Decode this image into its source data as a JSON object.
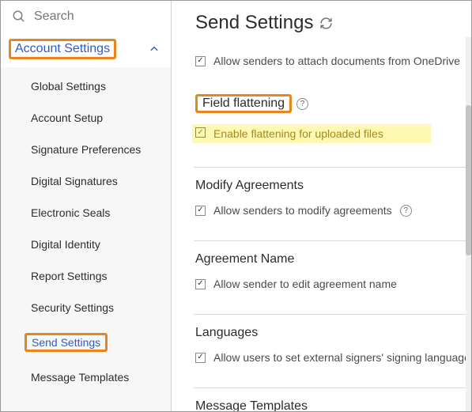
{
  "search": {
    "placeholder": "Search"
  },
  "sidebar": {
    "section_label": "Account Settings",
    "items": [
      {
        "label": "Global Settings"
      },
      {
        "label": "Account Setup"
      },
      {
        "label": "Signature Preferences"
      },
      {
        "label": "Digital Signatures"
      },
      {
        "label": "Electronic Seals"
      },
      {
        "label": "Digital Identity"
      },
      {
        "label": "Report Settings"
      },
      {
        "label": "Security Settings"
      },
      {
        "label": "Send Settings"
      },
      {
        "label": "Message Templates"
      }
    ]
  },
  "page": {
    "title": "Send Settings",
    "onedrive_option": "Allow senders to attach documents from OneDrive",
    "field_flattening": {
      "title": "Field flattening",
      "option": "Enable flattening for uploaded files"
    },
    "modify_agreements": {
      "title": "Modify Agreements",
      "option": "Allow senders to modify agreements"
    },
    "agreement_name": {
      "title": "Agreement Name",
      "option": "Allow sender to edit agreement name"
    },
    "languages": {
      "title": "Languages",
      "option": "Allow users to set external signers' signing language"
    },
    "message_templates": {
      "title": "Message Templates"
    }
  }
}
